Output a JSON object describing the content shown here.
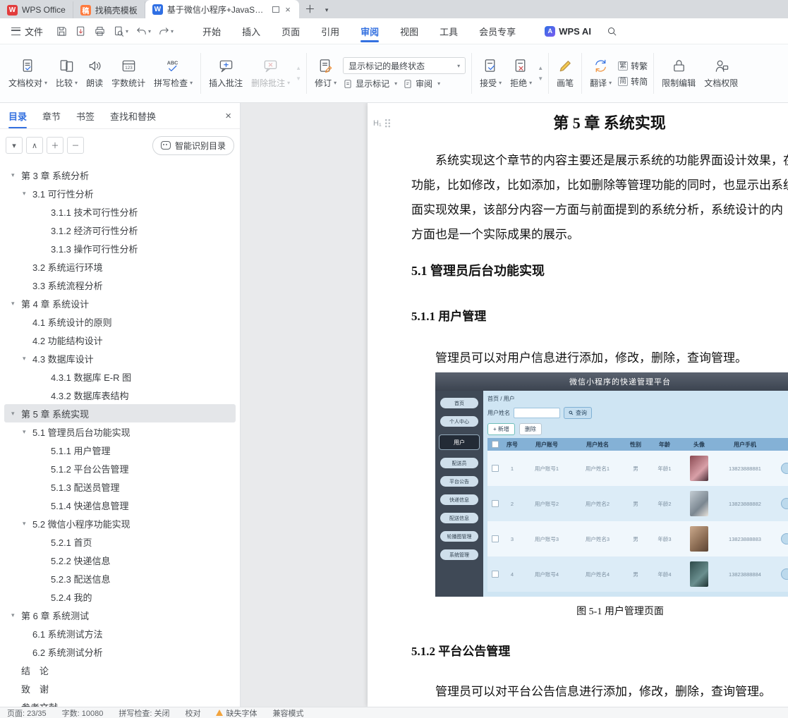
{
  "titlebar": {
    "tabs": [
      {
        "label": "WPS Office",
        "letter": "W",
        "icon_color": "#e23c3c",
        "active": false
      },
      {
        "label": "找稿壳模板",
        "letter": "稿",
        "icon_color": "#ff7a3d",
        "active": false
      },
      {
        "label": "基于微信小程序+JavaSSM+M",
        "letter": "W",
        "icon_color": "#2f6fe4",
        "active": true
      }
    ],
    "new_tab_icon": "＋",
    "tabs_menu_icon": "▾"
  },
  "menubar": {
    "file_label": "文件",
    "tabs": [
      "开始",
      "插入",
      "页面",
      "引用",
      "审阅",
      "视图",
      "工具",
      "会员专享"
    ],
    "active_tab_index": 4,
    "wps_ai_label": "WPS AI",
    "wps_ai_logo": "A"
  },
  "ribbon": {
    "doc_proof": "文档校对",
    "compare": "比较",
    "read_aloud": "朗读",
    "word_count": "字数统计",
    "spell_check": "拼写检查",
    "insert_comment": "插入批注",
    "delete_comment": "删除批注",
    "revise": "修订",
    "markup_state_dropdown": "显示标记的最终状态",
    "show_markup": "显示标记",
    "review": "审阅",
    "accept": "接受",
    "reject": "拒绝",
    "pen": "画笔",
    "translate": "翻译",
    "to_traditional": "转繁",
    "trad_icon": "繁",
    "to_simplified": "转简",
    "simp_icon": "简",
    "restrict_edit": "限制编辑",
    "doc_permission": "文档权限"
  },
  "sidebar": {
    "tabs": [
      "目录",
      "章节",
      "书签",
      "查找和替换"
    ],
    "active_tab_index": 0,
    "close_icon": "×",
    "toolbar_icons": {
      "collapse": "▾",
      "locate": "∧",
      "expand_all": "＋",
      "collapse_all": "－"
    },
    "smart_toc_button": "智能识别目录",
    "tree": [
      {
        "level": 0,
        "text": "第 3 章 系统分析",
        "expand": true
      },
      {
        "level": 1,
        "text": "3.1 可行性分析",
        "expand": true
      },
      {
        "level": 2,
        "text": "3.1.1 技术可行性分析"
      },
      {
        "level": 2,
        "text": "3.1.2 经济可行性分析"
      },
      {
        "level": 2,
        "text": "3.1.3 操作可行性分析"
      },
      {
        "level": 1,
        "text": "3.2 系统运行环境"
      },
      {
        "level": 1,
        "text": "3.3 系统流程分析"
      },
      {
        "level": 0,
        "text": "第 4 章 系统设计",
        "expand": true
      },
      {
        "level": 1,
        "text": "4.1 系统设计的原则"
      },
      {
        "level": 1,
        "text": "4.2 功能结构设计"
      },
      {
        "level": 1,
        "text": "4.3 数据库设计",
        "expand": true
      },
      {
        "level": 2,
        "text": "4.3.1 数据库 E-R 图"
      },
      {
        "level": 2,
        "text": "4.3.2 数据库表结构"
      },
      {
        "level": 0,
        "text": "第 5 章 系统实现",
        "expand": true,
        "selected": true
      },
      {
        "level": 1,
        "text": "5.1 管理员后台功能实现",
        "expand": true
      },
      {
        "level": 2,
        "text": "5.1.1 用户管理"
      },
      {
        "level": 2,
        "text": "5.1.2 平台公告管理"
      },
      {
        "level": 2,
        "text": "5.1.3 配送员管理"
      },
      {
        "level": 2,
        "text": "5.1.4 快递信息管理"
      },
      {
        "level": 1,
        "text": "5.2 微信小程序功能实现",
        "expand": true
      },
      {
        "level": 2,
        "text": "5.2.1 首页"
      },
      {
        "level": 2,
        "text": "5.2.2 快递信息"
      },
      {
        "level": 2,
        "text": "5.2.3 配送信息"
      },
      {
        "level": 2,
        "text": "5.2.4 我的"
      },
      {
        "level": 0,
        "text": "第 6 章 系统测试",
        "expand": true
      },
      {
        "level": 1,
        "text": "6.1 系统测试方法"
      },
      {
        "level": 1,
        "text": "6.2 系统测试分析"
      },
      {
        "level": 0,
        "text": "结　论"
      },
      {
        "level": 0,
        "text": "致　谢"
      },
      {
        "level": 0,
        "text": "参考文献"
      }
    ]
  },
  "document": {
    "heading_badge": "H₁",
    "chapter_title": "第 5 章 系统实现",
    "para1_lines": [
      "系统实现这个章节的内容主要还是展示系统的功能界面设计效果，在",
      "功能，比如修改，比如添加，比如删除等管理功能的同时，也显示出系统",
      "面实现效果，该部分内容一方面与前面提到的系统分析，系统设计的内",
      "方面也是一个实际成果的展示。"
    ],
    "h2_1": "5.1 管理员后台功能实现",
    "h3_1": "5.1.1 用户管理",
    "para2": "管理员可以对用户信息进行添加，修改，删除，查询管理。",
    "figure_caption": "图 5-1 用户管理页面",
    "h3_2": "5.1.2 平台公告管理",
    "para3": "管理员可以对平台公告信息进行添加，修改，删除，查询管理。"
  },
  "screenshot": {
    "header_title": "微信小程序的快递管理平台",
    "nav_top": [
      "首页",
      "个人中心"
    ],
    "nav_active": "用户",
    "nav_bottom": [
      "配送员",
      "平台公告",
      "快递信息",
      "配送信息",
      "轮播图管理",
      "系统管理"
    ],
    "breadcrumb": "首页 / 用户",
    "search_label": "用户姓名",
    "search_button": "查询",
    "add_button": "+ 新增",
    "delete_button": "删除",
    "table": {
      "headers": [
        "序号",
        "用户账号",
        "用户姓名",
        "性别",
        "年龄",
        "头像",
        "用户手机"
      ],
      "rows": [
        {
          "index": "1",
          "account": "用户账号1",
          "name": "用户姓名1",
          "gender": "男",
          "age": "年龄1",
          "phone": "13823888881"
        },
        {
          "index": "2",
          "account": "用户账号2",
          "name": "用户姓名2",
          "gender": "男",
          "age": "年龄2",
          "phone": "13823888882"
        },
        {
          "index": "3",
          "account": "用户账号3",
          "name": "用户姓名3",
          "gender": "男",
          "age": "年龄3",
          "phone": "13823888883"
        },
        {
          "index": "4",
          "account": "用户账号4",
          "name": "用户姓名4",
          "gender": "男",
          "age": "年龄4",
          "phone": "13823888884"
        }
      ]
    }
  },
  "statusbar": {
    "page": "页面: 23/35",
    "words": "字数: 10080",
    "spell": "拼写检查: 关闭",
    "proof": "校对",
    "missing_font": "缺失字体",
    "compat": "兼容模式"
  },
  "colors": {
    "accent_blue": "#3471e0",
    "warning_orange": "#f2a33c",
    "admin_header": "#3c4450",
    "admin_sidebar": "#3f4956",
    "admin_table_header": "#84b1d6",
    "admin_bg": "#cfe5f3"
  }
}
